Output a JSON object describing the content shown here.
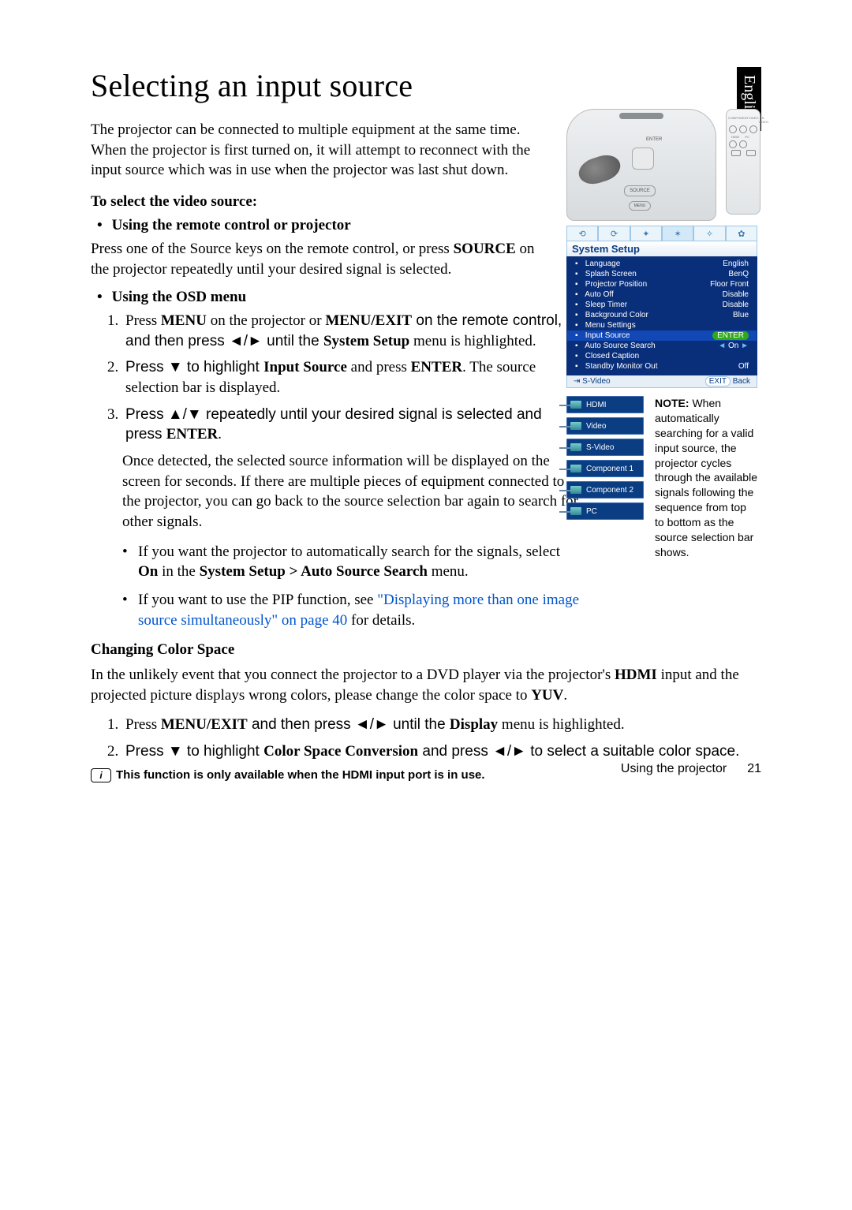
{
  "lang_tab": "English",
  "h1": "Selecting an input source",
  "intro": "The projector can be connected to multiple equipment at the same time. When the projector is first turned on, it will attempt to reconnect with the input source which was in use when the projector was last shut down.",
  "select_video_head": "To select the video source:",
  "method1_head": "Using the remote control or projector",
  "method1_body_a": "Press one of the Source keys on the remote control, or press ",
  "method1_body_b": "SOURCE",
  "method1_body_c": " on the projector repeatedly until your desired signal is selected.",
  "method2_head": "Using the OSD menu",
  "osd_step1_a": "Press ",
  "osd_step1_b": "MENU",
  "osd_step1_c": " on the projector or ",
  "osd_step1_d": "MENU/EXIT",
  "osd_step1_e": " on the remote control, and then press ◄/► until the ",
  "osd_step1_f": "System Setup",
  "osd_step1_g": " menu is highlighted.",
  "osd_step2_a": "Press ▼ to highlight ",
  "osd_step2_b": "Input Source",
  "osd_step2_c": " and press ",
  "osd_step2_d": "ENTER",
  "osd_step2_e": ". The source selection bar is displayed.",
  "osd_step3_a": "Press ▲/▼ repeatedly until your desired signal is selected and press ",
  "osd_step3_b": "ENTER",
  "osd_step3_c": ".",
  "osd_after": "Once detected, the selected source information will be displayed on the screen for seconds. If there are multiple pieces of equipment connected to the projector, you can go back to the source selection bar again to search for other signals.",
  "sub1_a": "If you want the projector to automatically search for the signals, select ",
  "sub1_b": "On",
  "sub1_c": " in the ",
  "sub1_d": "System Setup > Auto Source Search",
  "sub1_e": " menu.",
  "sub2_a": "If you want to use the PIP function, see ",
  "sub2_link": "\"Displaying more than one image source simultaneously\" on page 40",
  "sub2_b": " for details.",
  "color_head": "Changing Color Space",
  "color_para_a": "In the unlikely event that you connect the projector to a DVD player via the projector's ",
  "color_para_b": "HDMI",
  "color_para_c": " input and the projected picture displays wrong colors, please change the color space to ",
  "color_para_d": "YUV",
  "color_para_e": ".",
  "cs_step1_a": "Press ",
  "cs_step1_b": "MENU/EXIT",
  "cs_step1_c": " and then press ◄/► until the ",
  "cs_step1_d": "Display",
  "cs_step1_e": " menu is highlighted.",
  "cs_step2_a": "Press ▼ to highlight ",
  "cs_step2_b": "Color Space Conversion",
  "cs_step2_c": " and press ◄/► to select a suitable color space.",
  "final_note": "This function is only available when the HDMI input port is in use.",
  "footer_label": "Using the projector",
  "footer_page": "21",
  "projector_labels": {
    "enter": "ENTER",
    "source": "SOURCE",
    "menu": "MENU"
  },
  "remote_labels": {
    "r1": [
      "COMPONENT",
      "VIDEO",
      "S-VIDEO"
    ],
    "r2": [
      "HDMI",
      "PC",
      ""
    ]
  },
  "osd_menu": {
    "title": "System Setup",
    "rows": [
      {
        "label": "Language",
        "value": "English"
      },
      {
        "label": "Splash Screen",
        "value": "BenQ"
      },
      {
        "label": "Projector Position",
        "value": "Floor Front"
      },
      {
        "label": "Auto Off",
        "value": "Disable"
      },
      {
        "label": "Sleep Timer",
        "value": "Disable"
      },
      {
        "label": "Background Color",
        "value": "Blue"
      },
      {
        "label": "Menu Settings",
        "value": ""
      },
      {
        "label": "Input Source",
        "value": "ENTER",
        "hl": true,
        "enter": true
      },
      {
        "label": "Auto Source Search",
        "value": "On",
        "arrows": true
      },
      {
        "label": "Closed Caption",
        "value": ""
      },
      {
        "label": "Standby Monitor Out",
        "value": "Off"
      }
    ],
    "foot_left": "S-Video",
    "foot_right_pill": "EXIT",
    "foot_right": "Back"
  },
  "source_bar": [
    "HDMI",
    "Video",
    "S-Video",
    "Component 1",
    "Component 2",
    "PC"
  ],
  "side_note": {
    "bold": "NOTE: ",
    "text": "When automatically searching for a valid input source, the projector cycles through the available signals following the sequence from top to bottom as the source selection bar shows."
  }
}
